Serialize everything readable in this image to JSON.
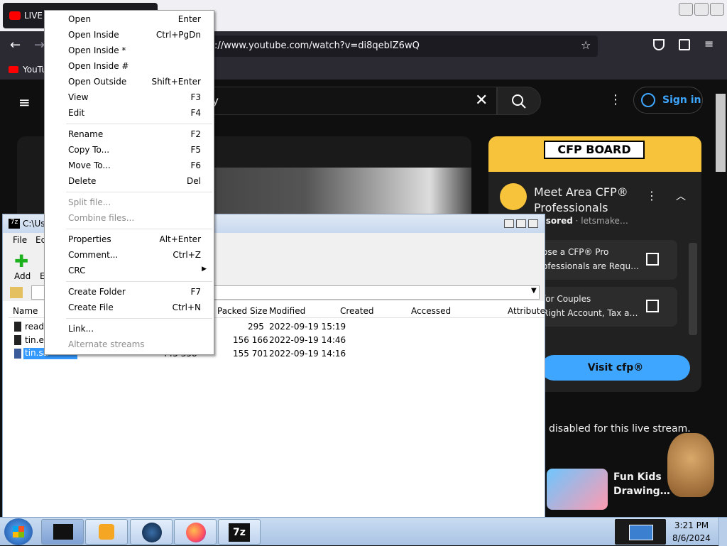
{
  "browser": {
    "tab_title": "LIVE",
    "url": "https://www.youtube.com/watch?v=di8qebIZ6wQ",
    "url_visible": "://www.youtube.com/watch?v=di8qebIZ6wQ",
    "bookmark": "YouTu"
  },
  "youtube": {
    "search_value": "y",
    "sign_in": "Sign in",
    "ad": {
      "brand": "CFP BOARD",
      "title": "Meet Area CFP® Professionals",
      "sponsor": "onsored",
      "advertiser": "letsmake…",
      "item1_title": "ose a CFP® Pro",
      "item1_sub": "ofessionals are Requ…",
      "item2_title": "for Couples",
      "item2_sub": "Right Account, Tax a…",
      "cta": "Visit cfp®"
    },
    "chat_disabled": "disabled for this live stream.",
    "rec_title": "Fun Kids Drawing…"
  },
  "sevenzip": {
    "title": "C:\\Us",
    "menu": [
      "File",
      "Ec"
    ],
    "toolbar_add": "Add",
    "toolbar_e": "E",
    "columns": [
      "Name",
      "Packed Size",
      "Modified",
      "Created",
      "Accessed",
      "Attribute"
    ],
    "rows": [
      {
        "name": "readr",
        "size": "",
        "packed": "295",
        "modified": "2022-09-19 15:19"
      },
      {
        "name": "tin.ex",
        "size": "",
        "packed": "156 166",
        "modified": "2022-09-19 14:46"
      },
      {
        "name": "tin.sa",
        "size": "445 358",
        "packed": "155 701",
        "modified": "2022-09-19 14:16"
      }
    ]
  },
  "context_menu": [
    {
      "label": "Open",
      "shortcut": "Enter",
      "disabled": false
    },
    {
      "label": "Open Inside",
      "shortcut": "Ctrl+PgDn",
      "disabled": false
    },
    {
      "label": "Open Inside *",
      "shortcut": "",
      "disabled": false
    },
    {
      "label": "Open Inside #",
      "shortcut": "",
      "disabled": false
    },
    {
      "label": "Open Outside",
      "shortcut": "Shift+Enter",
      "disabled": false
    },
    {
      "label": "View",
      "shortcut": "F3",
      "disabled": false
    },
    {
      "label": "Edit",
      "shortcut": "F4",
      "disabled": false
    },
    {
      "label": "Rename",
      "shortcut": "F2",
      "disabled": false
    },
    {
      "label": "Copy To...",
      "shortcut": "F5",
      "disabled": false
    },
    {
      "label": "Move To...",
      "shortcut": "F6",
      "disabled": false
    },
    {
      "label": "Delete",
      "shortcut": "Del",
      "disabled": false
    },
    {
      "label": "Split file...",
      "shortcut": "",
      "disabled": true
    },
    {
      "label": "Combine files...",
      "shortcut": "",
      "disabled": true
    },
    {
      "label": "Properties",
      "shortcut": "Alt+Enter",
      "disabled": false
    },
    {
      "label": "Comment...",
      "shortcut": "Ctrl+Z",
      "disabled": false
    },
    {
      "label": "CRC",
      "shortcut": "",
      "disabled": false
    },
    {
      "label": "Create Folder",
      "shortcut": "F7",
      "disabled": false
    },
    {
      "label": "Create File",
      "shortcut": "Ctrl+N",
      "disabled": false
    },
    {
      "label": "Link...",
      "shortcut": "",
      "disabled": false
    },
    {
      "label": "Alternate streams",
      "shortcut": "",
      "disabled": true
    }
  ],
  "taskbar": {
    "time": "3:21 PM",
    "date": "8/6/2024"
  },
  "colors": {
    "yt_bg": "#0f0f0f",
    "ad_yellow": "#f7c33b",
    "cta_blue": "#3ea6ff",
    "selection": "#3399ff"
  }
}
